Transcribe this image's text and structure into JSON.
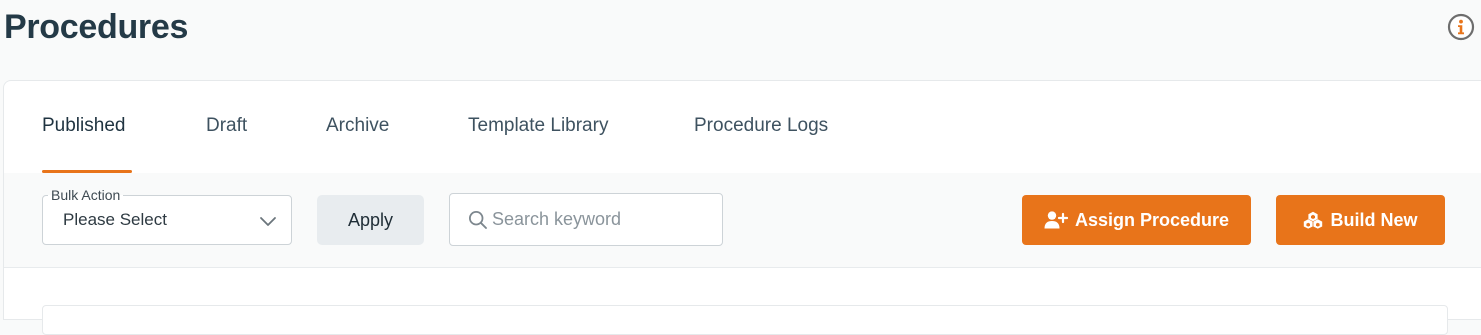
{
  "page": {
    "title": "Procedures"
  },
  "header": {
    "info_icon": "info-circle-icon"
  },
  "tabs": [
    {
      "label": "Published",
      "active": true
    },
    {
      "label": "Draft",
      "active": false
    },
    {
      "label": "Archive",
      "active": false
    },
    {
      "label": "Template Library",
      "active": false
    },
    {
      "label": "Procedure Logs",
      "active": false
    }
  ],
  "toolbar": {
    "bulk_action": {
      "label": "Bulk Action",
      "selected": "Please Select",
      "icon": "chevron-down-icon"
    },
    "apply_label": "Apply",
    "search": {
      "placeholder": "Search keyword",
      "value": "",
      "icon": "search-icon"
    },
    "assign_label": "Assign Procedure",
    "assign_icon": "user-plus-icon",
    "build_label": "Build New",
    "build_icon": "cubes-icon"
  },
  "colors": {
    "accent": "#e8741a",
    "title": "#243a47",
    "background": "#f9fafa",
    "card": "#ffffff",
    "apply_bg": "#e8ecef"
  }
}
